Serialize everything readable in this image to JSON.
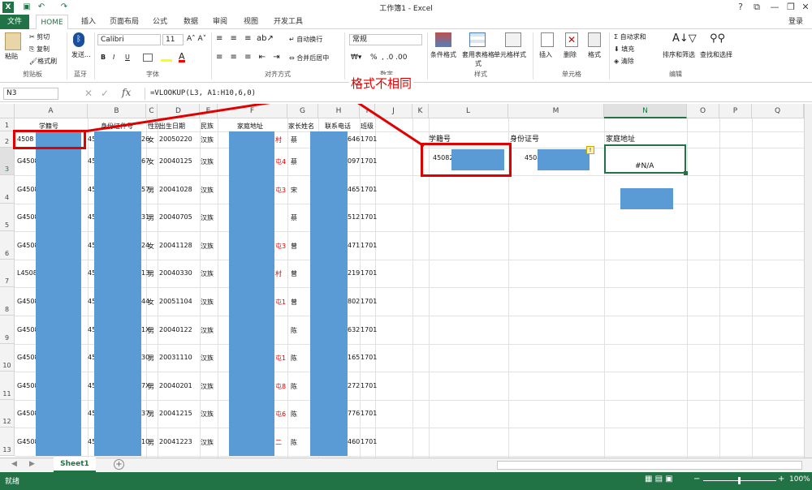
{
  "window": {
    "title": "工作簿1 - Excel",
    "help": "?",
    "login": "登录"
  },
  "tabs": [
    "文件",
    "HOME",
    "插入",
    "页面布局",
    "公式",
    "数据",
    "审阅",
    "视图",
    "开发工具"
  ],
  "ribbon": {
    "clipboard": {
      "paste": "粘贴",
      "cut": "剪切",
      "copy": "复制",
      "format_painter": "格式刷",
      "label": "剪贴板"
    },
    "bluetooth": {
      "send": "发送...",
      "label": "蓝牙"
    },
    "font": {
      "name": "Calibri",
      "size": "11",
      "bold": "B",
      "italic": "I",
      "underline": "U",
      "label": "字体"
    },
    "alignment": {
      "wrap": "自动换行",
      "merge": "合并后居中",
      "label": "对齐方式"
    },
    "number": {
      "format": "常规",
      "label": "数字",
      "percent": "%"
    },
    "styles": {
      "conditional": "条件格式",
      "table": "套用表格格式",
      "cell_styles": "单元格样式",
      "label": "样式"
    },
    "cells": {
      "insert": "插入",
      "delete": "删除",
      "format": "格式",
      "label": "单元格"
    },
    "editing": {
      "autosum": "自动求和",
      "fill": "填充",
      "clear": "清除",
      "sort": "排序和筛选",
      "find": "查找和选择",
      "label": "编辑"
    }
  },
  "formula_bar": {
    "name_box": "N3",
    "formula": "=VLOOKUP(L3, A1:H10,6,0)"
  },
  "annotation": "格式不相同",
  "columns": [
    "A",
    "B",
    "C",
    "D",
    "E",
    "F",
    "G",
    "H",
    "I",
    "J",
    "K",
    "L",
    "M",
    "N",
    "O",
    "P",
    "Q"
  ],
  "header_row": {
    "a": "学籍号",
    "b": "身份证件号",
    "c": "性别",
    "d": "出生日期",
    "e": "民族",
    "f": "家庭地址",
    "g": "家长姓名",
    "h": "联系电话",
    "i": "班级"
  },
  "rows": [
    {
      "num": "2",
      "a": "4508",
      "b": "45",
      "b2": "26",
      "c": "女",
      "d": "20050220",
      "e": "汉族",
      "g": "蔡",
      "h": "646",
      "i": "1701",
      "f2": "村"
    },
    {
      "num": "3",
      "a": "G4508",
      "b": "45",
      "b2": "67",
      "c": "女",
      "d": "20040125",
      "e": "汉族",
      "g": "蔡",
      "h": "097",
      "i": "1701",
      "f2": "屯4"
    },
    {
      "num": "4",
      "a": "G4508",
      "b": "45",
      "b2": "57",
      "c": "男",
      "d": "20041028",
      "e": "汉族",
      "g": "宋",
      "h": "465",
      "i": "1701",
      "f2": "屯3"
    },
    {
      "num": "5",
      "a": "G4508",
      "b": "45",
      "b2": "31",
      "c": "男",
      "d": "20040705",
      "e": "汉族",
      "g": "蔡",
      "h": "512",
      "i": "1701",
      "f2": ""
    },
    {
      "num": "6",
      "a": "G4508",
      "b": "45",
      "b2": "24",
      "c": "女",
      "d": "20041128",
      "e": "汉族",
      "g": "曾",
      "h": "471",
      "i": "1701",
      "f2": "屯3"
    },
    {
      "num": "7",
      "a": "L4508",
      "b": "45",
      "b2": "13",
      "c": "男",
      "d": "20040330",
      "e": "汉族",
      "g": "曾",
      "h": "219",
      "i": "1701",
      "f2": "村"
    },
    {
      "num": "8",
      "a": "G4508",
      "b": "45",
      "b2": "44",
      "c": "女",
      "d": "20051104",
      "e": "汉族",
      "g": "曾",
      "h": "802",
      "i": "1701",
      "f2": "屯1"
    },
    {
      "num": "9",
      "a": "G4508",
      "b": "45",
      "b2": "1X",
      "c": "男",
      "d": "20040122",
      "e": "汉族",
      "g": "陈",
      "h": "632",
      "i": "1701",
      "f2": ""
    },
    {
      "num": "10",
      "a": "G4508",
      "b": "45",
      "b2": "30",
      "c": "男",
      "d": "20031110",
      "e": "汉族",
      "g": "陈",
      "h": "165",
      "i": "1701",
      "f2": "屯1"
    },
    {
      "num": "11",
      "a": "G4508",
      "b": "45",
      "b2": "7X",
      "c": "男",
      "d": "20040201",
      "e": "汉族",
      "g": "陈",
      "h": "272",
      "i": "1701",
      "f2": "屯8"
    },
    {
      "num": "12",
      "a": "G4508",
      "b": "45",
      "b2": "37",
      "c": "男",
      "d": "20041215",
      "e": "汉族",
      "g": "陈",
      "h": "776",
      "i": "1701",
      "f2": "屯6"
    },
    {
      "num": "13",
      "a": "G4508",
      "b": "45",
      "b2": "10",
      "c": "男",
      "d": "20041223",
      "e": "汉族",
      "g": "陈",
      "h": "460",
      "i": "1701",
      "f2": "二"
    }
  ],
  "lookup": {
    "l_header": "学籍号",
    "m_header": "身份证号",
    "n_header": "家庭地址",
    "l_value": "450821",
    "m_value": "4508",
    "n_value": "#N/A"
  },
  "sheet": {
    "name": "Sheet1",
    "add": "+"
  },
  "status": {
    "ready": "就绪",
    "zoom": "100%"
  },
  "colors": {
    "accent": "#217346",
    "mask": "#5b9bd5",
    "annotation": "#e00000"
  }
}
